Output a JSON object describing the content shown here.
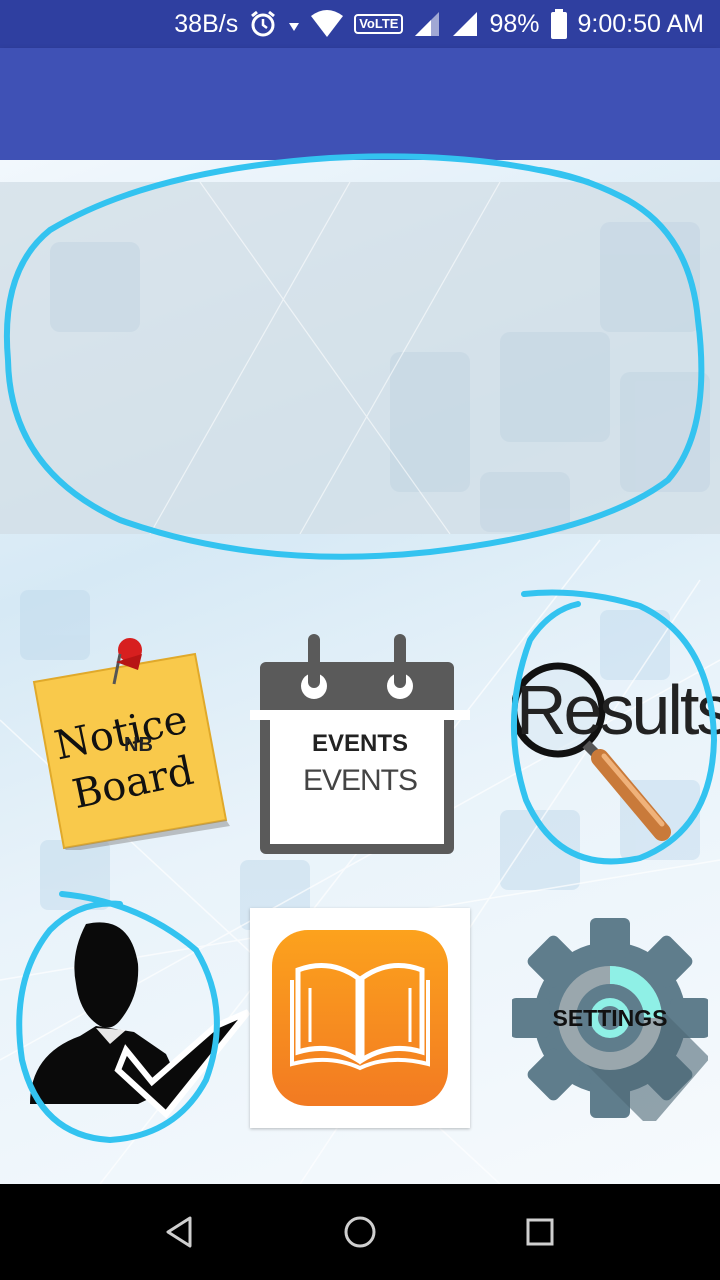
{
  "status_bar": {
    "net_speed": "38B/s",
    "volte": "VoLTE",
    "battery": "98%",
    "time": "9:00:50 AM"
  },
  "tiles": {
    "notice_board": {
      "line1": "Notice",
      "line2": "Board",
      "label": "NB"
    },
    "events": {
      "label_bold": "EVENTS",
      "label": "EVENTS"
    },
    "results": {
      "label": "Results"
    },
    "settings": {
      "label": "SETTINGS"
    }
  },
  "icons": {
    "alarm": "alarm-icon",
    "wifi": "wifi-icon",
    "signal": "signal-icon",
    "battery": "battery-icon",
    "back": "back-icon",
    "home": "home-icon",
    "recents": "recents-icon",
    "notice_board": "notice-board-icon",
    "events": "calendar-icon",
    "results": "magnifier-icon",
    "profile": "person-icon",
    "library": "book-icon",
    "settings": "gear-icon"
  },
  "colors": {
    "status_bar": "#2f3fa0",
    "app_bar": "#3f51b5",
    "annotation": "#33c3f0",
    "book_orange": "#f58a1f"
  }
}
